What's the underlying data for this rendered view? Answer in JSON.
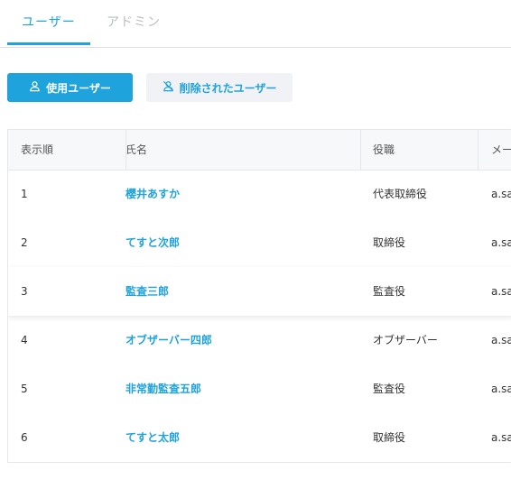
{
  "tabs": [
    "ユーザー",
    "アドミン"
  ],
  "buttons": {
    "active_users": "使用ユーザー",
    "deleted_users": "削除されたユーザー"
  },
  "icons": {
    "active_users": "user-icon",
    "deleted_users": "user-slash-icon"
  },
  "colors": {
    "accent": "#1fa3dc"
  },
  "table": {
    "headers": [
      "表示順",
      "氏名",
      "役職",
      "メー"
    ],
    "rows": [
      {
        "order": "1",
        "name": "櫻井あすか",
        "role": "代表取締役",
        "email": "a.sa"
      },
      {
        "order": "2",
        "name": "てすと次郎",
        "role": "取締役",
        "email": "a.sa"
      },
      {
        "order": "3",
        "name": "監査三郎",
        "role": "監査役",
        "email": "a.sa"
      },
      {
        "order": "4",
        "name": "オブザーバー四郎",
        "role": "オブザーバー",
        "email": "a.sa"
      },
      {
        "order": "5",
        "name": "非常勤監査五郎",
        "role": "監査役",
        "email": "a.sa"
      },
      {
        "order": "6",
        "name": "てすと太郎",
        "role": "取締役",
        "email": "a.sa"
      }
    ]
  }
}
